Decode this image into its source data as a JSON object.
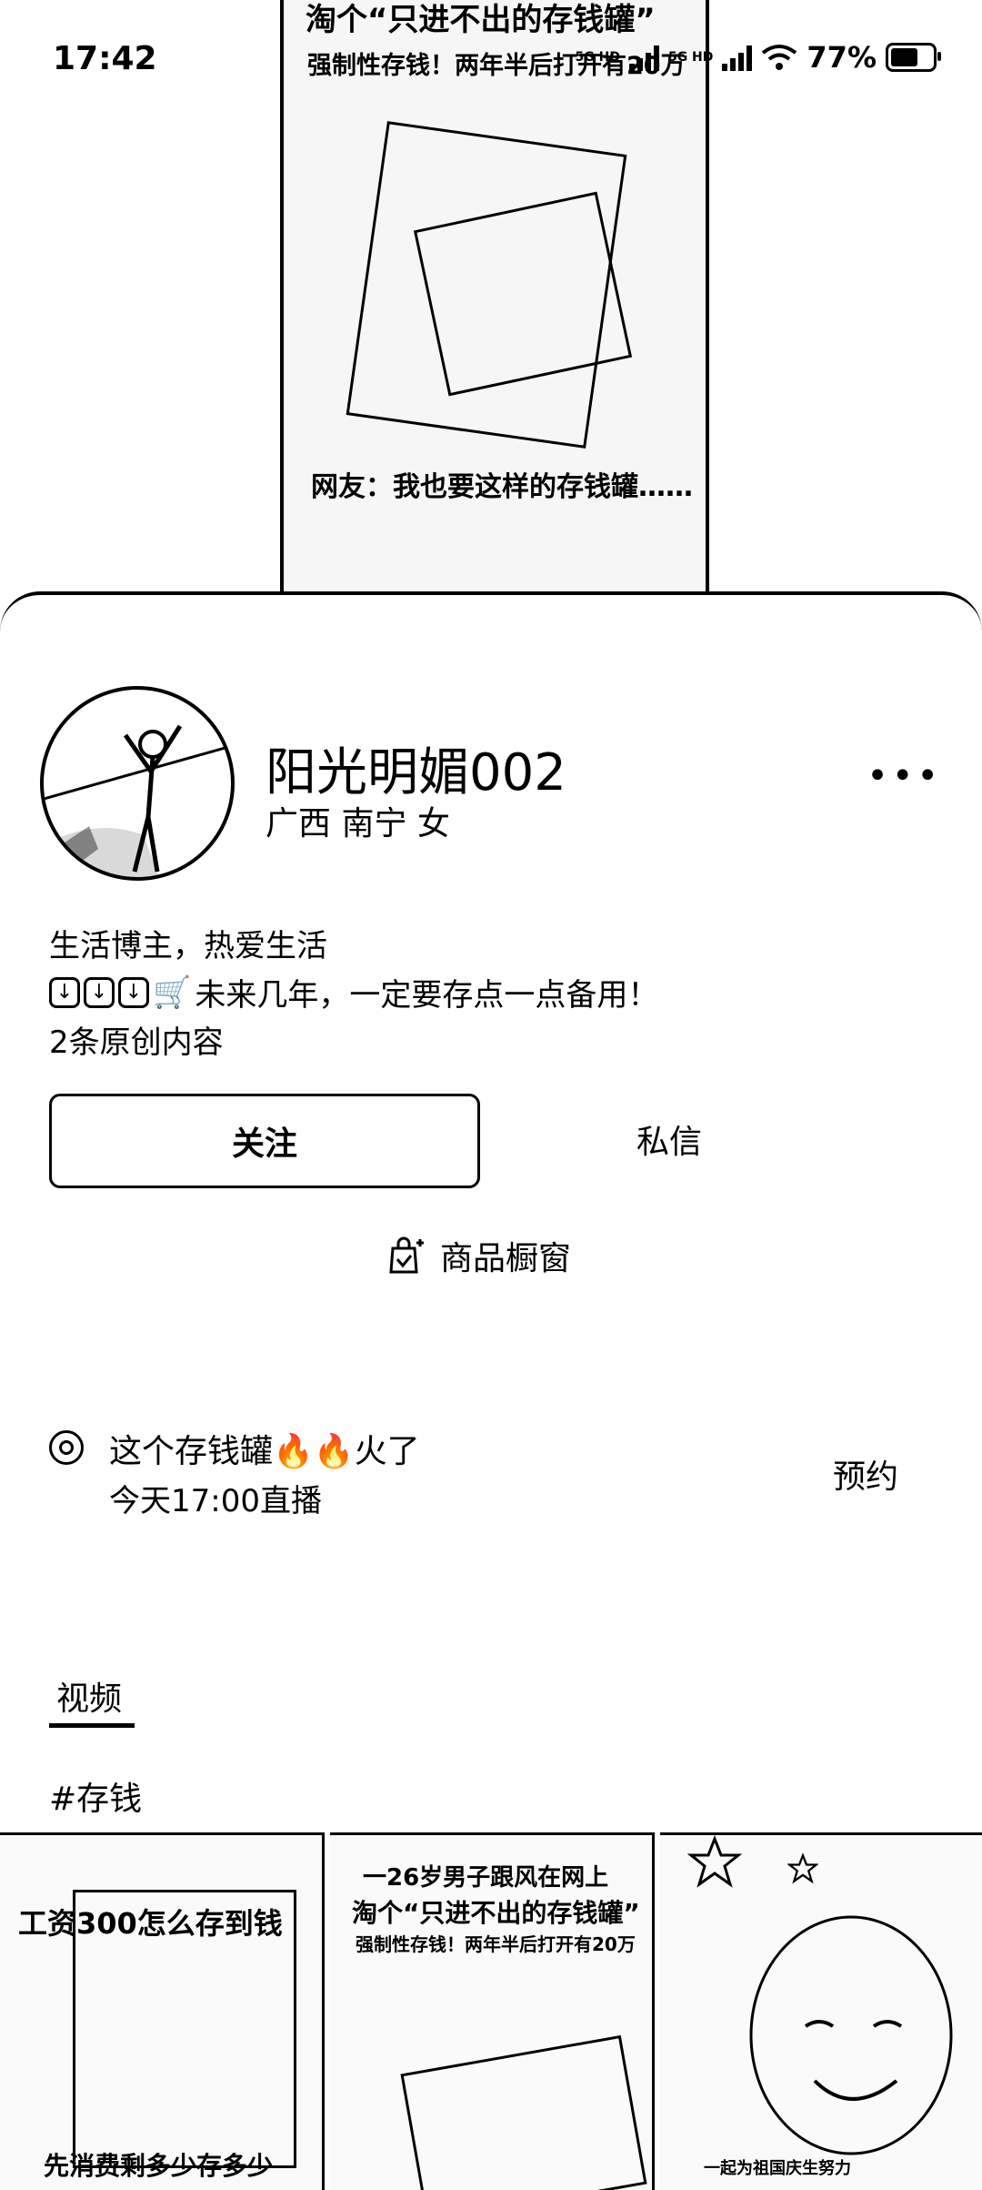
{
  "status_bar": {
    "time": "17:42",
    "network_badges": [
      "5G HD",
      "5G HD"
    ],
    "battery": "77%",
    "battery_level": 0.77,
    "icons": [
      "signal-icon",
      "wifi-icon",
      "battery-icon"
    ]
  },
  "video": {
    "headline": "淘个“只进不出的存钱罐”",
    "subheadline": "强制性存钱！两年半后打开有20万",
    "subtitle": "网友：我也要这样的存钱罐……"
  },
  "profile": {
    "username": "阳光明媚002",
    "location": "广西 南宁 女",
    "bio_line1": "生活博主，热爱生活",
    "bio_line2_text": "未来几年，一定要存点一点备用！",
    "original_count": "2条原创内容"
  },
  "actions": {
    "follow": "关注",
    "message": "私信",
    "shop": "商品橱窗"
  },
  "live": {
    "title": "这个存钱罐🔥🔥火了",
    "time": "今天17:00直播",
    "reserve": "预约"
  },
  "tabs": {
    "videos": "视频"
  },
  "hashtag": "#存钱",
  "thumbnails": [
    {
      "top": "工资300怎么存到钱",
      "bottom": "先消费剩多少存多少"
    },
    {
      "top": "一26岁男子跟风在网上",
      "middle": "淘个“只进不出的存钱罐”",
      "bottom": "强制性存钱！两年半后打开有20万"
    },
    {
      "bottom": "一起为祖国庆生努力"
    }
  ]
}
